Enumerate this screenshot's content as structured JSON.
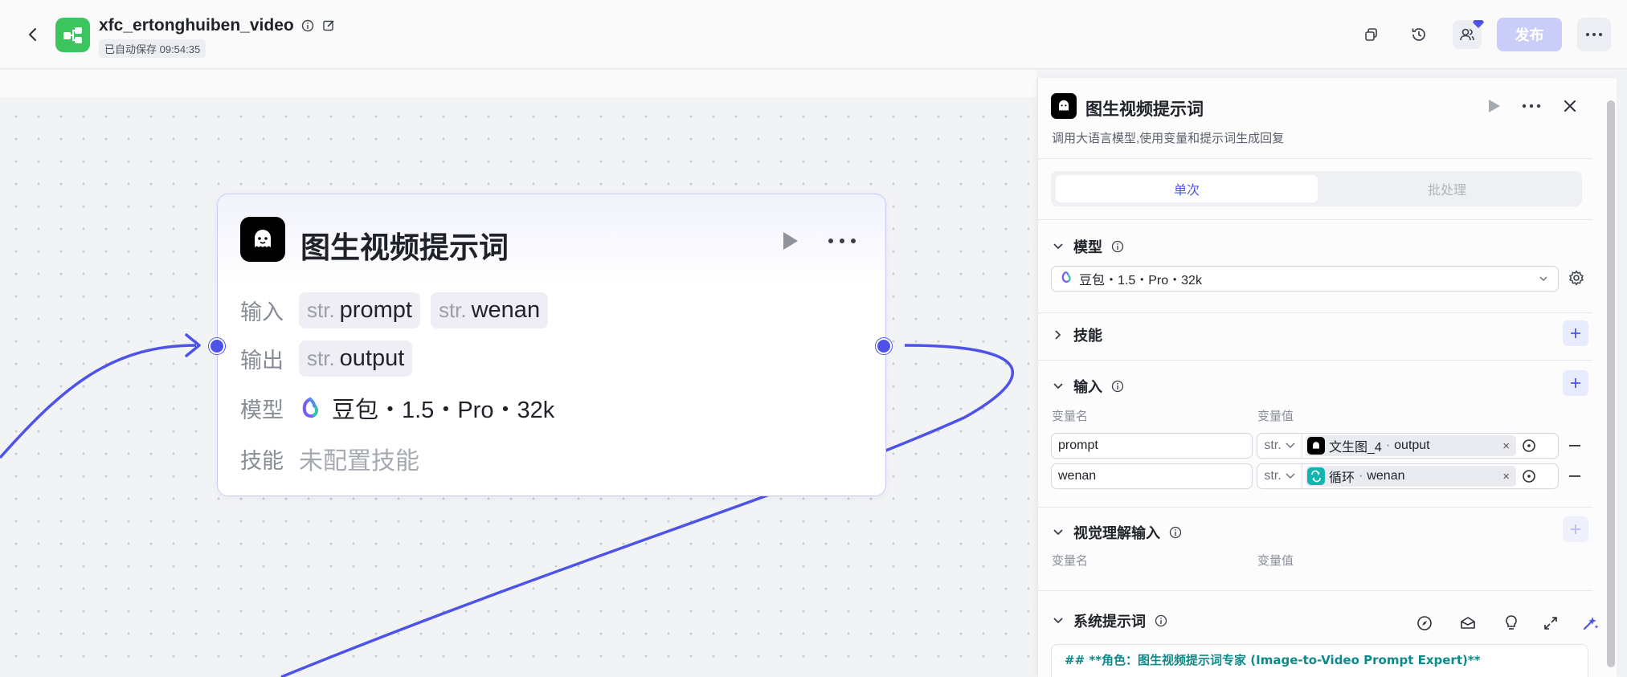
{
  "app": {
    "title": "xfc_ertonghuiben_video",
    "autosave": "已自动保存 09:54:35",
    "publish_label": "发布",
    "accent": "#4d53e8"
  },
  "node": {
    "title": "图生视频提示词",
    "input_label": "输入",
    "output_label": "输出",
    "model_label": "模型",
    "skill_label": "技能",
    "inputs": [
      {
        "type": "str.",
        "name": "prompt"
      },
      {
        "type": "str.",
        "name": "wenan"
      }
    ],
    "outputs": [
      {
        "type": "str.",
        "name": "output"
      }
    ],
    "model": "豆包・1.5・Pro・32k",
    "skill_value": "未配置技能"
  },
  "panel": {
    "title": "图生视频提示词",
    "description": "调用大语言模型,使用变量和提示词生成回复",
    "tabs": {
      "single": "单次",
      "batch": "批处理"
    },
    "model_section": "模型",
    "model_value": "豆包・1.5・Pro・32k",
    "skills_section": "技能",
    "input_section": "输入",
    "var_name_col": "变量名",
    "var_value_col": "变量值",
    "input_vars": [
      {
        "name": "prompt",
        "type": "str.",
        "ref_node": "文生图_4",
        "ref_field": "output",
        "ref_sep": " · "
      },
      {
        "name": "wenan",
        "type": "str.",
        "ref_node": "循环",
        "ref_field": "wenan",
        "ref_sep": " · "
      }
    ],
    "vision_section": "视觉理解输入",
    "vision_name_col": "变量名",
    "vision_value_col": "变量值",
    "system_prompt_section": "系统提示词",
    "system_prompt_first_line": "## **角色：图生视频提示词专家 (Image-to-Video Prompt Expert)**"
  },
  "icons": {
    "back": "chevron-left-icon",
    "logo": "workflow-icon",
    "info": "info-icon",
    "edit": "edit-icon",
    "copy": "copy-icon",
    "history": "history-icon",
    "users": "users-icon",
    "more": "more-horizontal-icon",
    "run": "play-icon",
    "close": "close-icon",
    "settings": "gear-icon"
  }
}
